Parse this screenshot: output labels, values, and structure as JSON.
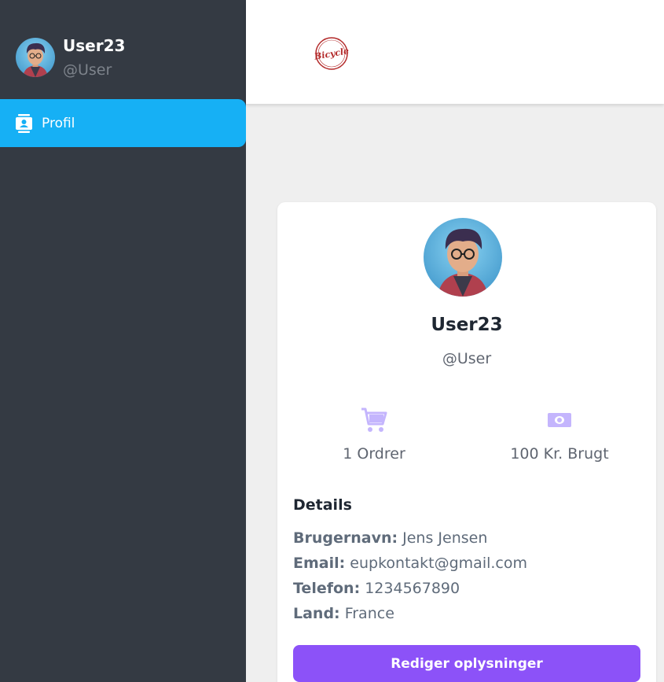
{
  "colors": {
    "sidebar_bg": "#343a43",
    "nav_active": "#16b0f5",
    "accent_button": "#8c52f8",
    "icon_accent": "#c4b5fd"
  },
  "sidebar": {
    "user_name": "User23",
    "user_handle": "@User",
    "nav": [
      {
        "label": "Profil",
        "icon": "contact-card-icon",
        "active": true
      }
    ]
  },
  "header": {
    "logo_text": "Bicycle"
  },
  "profile": {
    "name": "User23",
    "handle": "@User",
    "stats": [
      {
        "icon": "cart-icon",
        "label": "1 Ordrer"
      },
      {
        "icon": "money-icon",
        "label": "100 Kr. Brugt"
      }
    ],
    "details_title": "Details",
    "details": [
      {
        "key": "Brugernavn:",
        "value": "Jens Jensen"
      },
      {
        "key": "Email:",
        "value": "eupkontakt@gmail.com"
      },
      {
        "key": "Telefon:",
        "value": "1234567890"
      },
      {
        "key": "Land:",
        "value": "France"
      }
    ],
    "edit_button": "Rediger oplysninger"
  }
}
